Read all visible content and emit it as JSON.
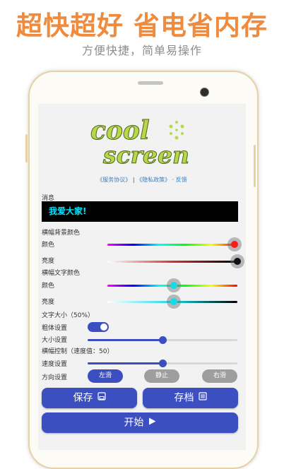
{
  "promo": {
    "headline": "超快超好  省电省内存",
    "subline": "方便快捷，简单易操作"
  },
  "app": {
    "logo": {
      "line1": "cool",
      "line2": "screen"
    },
    "links": {
      "service": "《服务协议》",
      "separator": "|",
      "privacy": "《隐私政策》",
      "dot": "·",
      "feedback": "反馈"
    },
    "message": {
      "label": "消息",
      "value": "我爱大家!"
    },
    "banner_bg": {
      "label": "横幅背景颜色",
      "color_label": "颜色",
      "color_value": 0.98,
      "color_thumb": "#ff1a1a",
      "brightness_label": "亮度",
      "brightness_value": 1.0,
      "brightness_thumb": "#111111"
    },
    "banner_text": {
      "label": "横幅文字颜色",
      "color_label": "颜色",
      "color_value": 0.51,
      "color_thumb": "#19d9e6",
      "brightness_label": "亮度",
      "brightness_value": 0.51,
      "brightness_thumb": "#19d9e6"
    },
    "text_size": {
      "label": "文字大小（50%）",
      "bold_label": "粗体设置",
      "bold_on": true,
      "size_label": "大小设置",
      "size_value": 0.5
    },
    "banner_control": {
      "label": "横幅控制（速度值：50）",
      "speed_label": "速度设置",
      "speed_value": 0.5,
      "direction_label": "方向设置",
      "left": "左滑",
      "stop": "静止",
      "right": "右滑"
    },
    "buttons": {
      "save": "保存",
      "archive": "存档",
      "start": "开始"
    },
    "colors": {
      "accent": "#3b4fc1",
      "promo": "#f08a3c",
      "message_text": "#00e5ff",
      "inactive_pill": "#9e9e9e"
    },
    "icons": {
      "save": "save-icon",
      "archive": "list-icon",
      "start": "play-icon"
    }
  }
}
